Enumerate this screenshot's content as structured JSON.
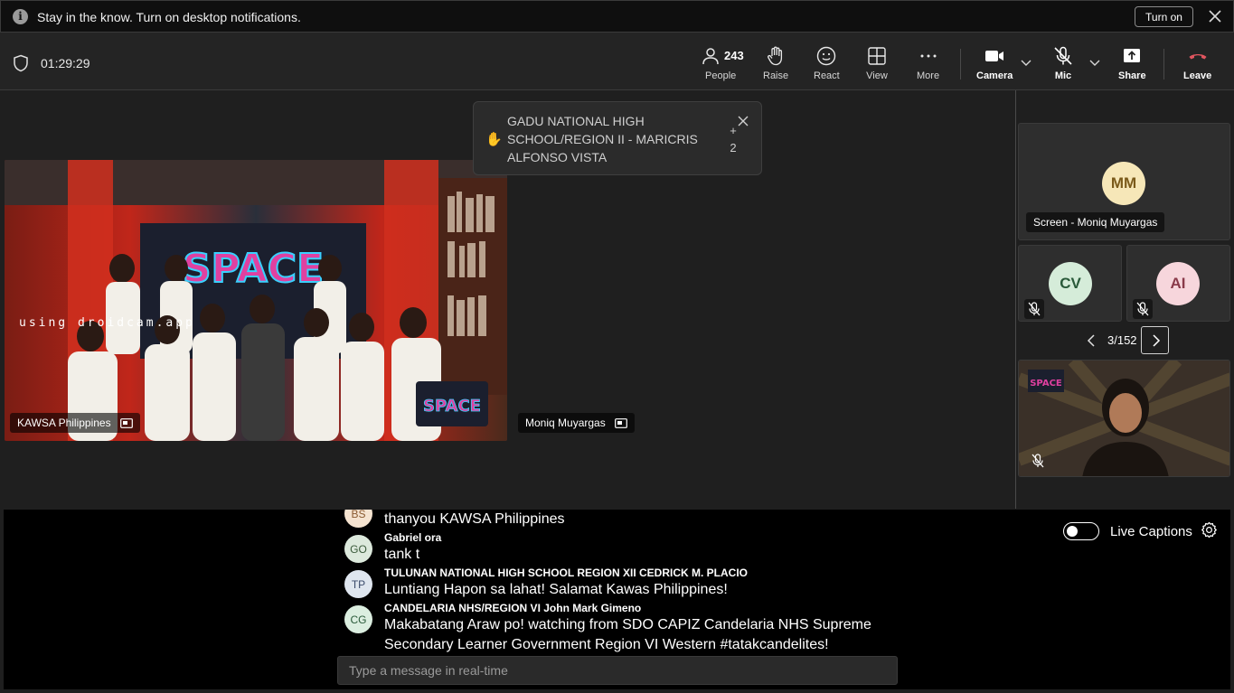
{
  "notification": {
    "message": "Stay in the know. Turn on desktop notifications.",
    "turn_on_label": "Turn on"
  },
  "toolbar": {
    "timer": "01:29:29",
    "people_count": "243",
    "people_label": "People",
    "raise_label": "Raise",
    "react_label": "React",
    "view_label": "View",
    "more_label": "More",
    "camera_label": "Camera",
    "mic_label": "Mic",
    "share_label": "Share",
    "leave_label": "Leave"
  },
  "raise_hand_toast": {
    "text": "GADU NATIONAL HIGH SCHOOL/REGION II - MARICRIS ALFONSO VISTA",
    "more_prefix": "+",
    "more_count": "2"
  },
  "stage": {
    "main_video_name": "KAWSA Philippines",
    "watermark": "using droidcam.app",
    "screen_share_name": "Moniq Muyargas"
  },
  "gallery": {
    "tiles": [
      {
        "initials": "MM",
        "label": "Screen - Moniq Muyargas"
      },
      {
        "initials": "CV"
      },
      {
        "initials": "AI"
      }
    ],
    "page": "3/152"
  },
  "captions": {
    "live_captions_label": "Live Captions",
    "input_placeholder": "Type a message in real-time",
    "messages": [
      {
        "initials": "BS",
        "name": "",
        "text": "thanyou KAWSA Philippines"
      },
      {
        "initials": "GO",
        "name": "Gabriel ora",
        "text": "tank t"
      },
      {
        "initials": "TP",
        "name": "TULUNAN NATIONAL HIGH SCHOOL REGION XII CEDRICK M. PLACIO",
        "text": "Luntiang Hapon sa lahat! Salamat Kawas Philippines!"
      },
      {
        "initials": "CG",
        "name": "CANDELARIA NHS/REGION VI John Mark Gimeno",
        "text": "Makabatang Araw po! watching from SDO CAPIZ Candelaria NHS Supreme",
        "text2": "Secondary Learner Government Region VI Western  #tatakcandelites!"
      }
    ]
  },
  "colors": {
    "leave_red": "#e0555f",
    "avatar_mm": "#f6e7b8",
    "avatar_cv": "#d5ecd9",
    "avatar_ai": "#f7d6dc",
    "chat_bs": "#f5e3d0",
    "chat_go": "#dce9dc",
    "chat_tp": "#dfe6ef",
    "chat_cg": "#dbeee0"
  }
}
